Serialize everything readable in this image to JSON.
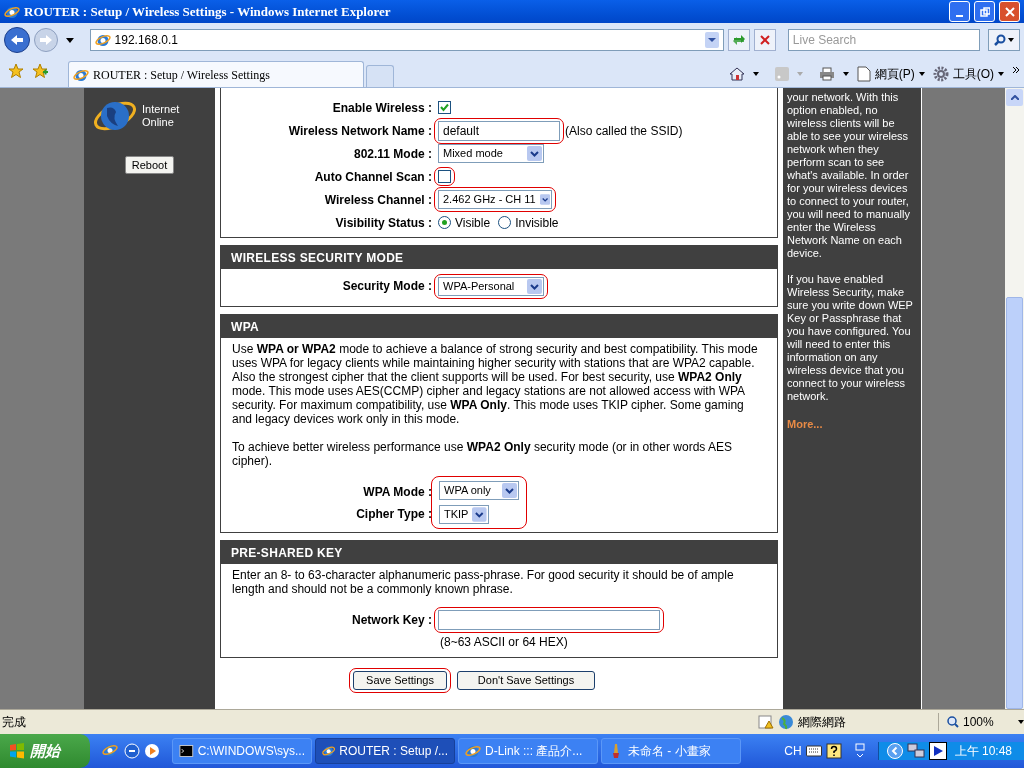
{
  "window": {
    "title": "ROUTER : Setup / Wireless Settings - Windows Internet Explorer"
  },
  "address_bar": {
    "url": "192.168.0.1",
    "search_placeholder": "Live Search"
  },
  "tabs": [
    {
      "label": "ROUTER : Setup / Wireless Settings",
      "selected": true
    }
  ],
  "command_bar": {
    "page_menu": "網頁(P)",
    "tools_menu": "工具(O)"
  },
  "router_sidebar": {
    "status": "Internet Online",
    "reboot": "Reboot"
  },
  "sections": [
    {
      "fields": [
        {
          "kind": "checkbox",
          "label": "Enable Wireless :",
          "checked": true,
          "highlighted": false
        },
        {
          "kind": "text",
          "label": "Wireless Network Name :",
          "value": "default",
          "note": "(Also called the SSID)",
          "highlighted": true
        },
        {
          "kind": "select",
          "label": "802.11 Mode :",
          "value": "Mixed mode",
          "highlighted": false
        },
        {
          "kind": "checkbox",
          "label": "Auto Channel Scan :",
          "checked": false,
          "highlighted": true
        },
        {
          "kind": "select",
          "label": "Wireless Channel :",
          "value": "2.462 GHz - CH 11",
          "highlighted": true
        },
        {
          "kind": "radio",
          "label": "Visibility Status :",
          "highlighted": false,
          "options": [
            {
              "label": "Visible",
              "selected": true
            },
            {
              "label": "Invisible",
              "selected": false
            }
          ]
        }
      ]
    },
    {
      "title": "WIRELESS SECURITY MODE",
      "fields": [
        {
          "kind": "select",
          "label": "Security Mode :",
          "value": "WPA-Personal",
          "highlighted": true
        }
      ]
    },
    {
      "title": "WPA",
      "paragraphs": [
        "Use **WPA or WPA2** mode to achieve a balance of strong security and best compatibility. This mode uses WPA for legacy clients while maintaining higher security with stations that are WPA2 capable. Also the strongest cipher that the client supports will be used. For best security, use **WPA2 Only** mode. This mode uses AES(CCMP) cipher and legacy stations are not allowed access with WPA security. For maximum compatibility, use **WPA Only**. This mode uses TKIP cipher. Some gaming and legacy devices work only in this mode.",
        "To achieve better wireless performance use **WPA2 Only** security mode (or in other words AES cipher)."
      ],
      "group_highlighted": true,
      "fields": [
        {
          "kind": "select",
          "label": "WPA Mode :",
          "value": "WPA only",
          "highlighted": false
        },
        {
          "kind": "select",
          "label": "Cipher Type :",
          "value": "TKIP",
          "highlighted": false
        }
      ]
    },
    {
      "title": "PRE-SHARED KEY",
      "paragraphs": [
        "Enter an 8- to 63-character alphanumeric pass-phrase. For good security it should be of ample length and should not be a commonly known phrase."
      ],
      "fields": [
        {
          "kind": "text",
          "label": "Network Key :",
          "highlighted": true,
          "hint": "(8~63 ASCII or 64 HEX)"
        }
      ]
    }
  ],
  "buttons": [
    {
      "label": "Save Settings",
      "highlighted": true
    },
    {
      "label": "Don't Save Settings",
      "highlighted": false
    }
  ],
  "help": {
    "paragraphs": [
      "your network. With this option enabled, no wireless clients will be able to see your wireless network when they perform scan to see what's available. In order for your wireless devices to connect to your router, you will need to manually enter the Wireless Network Name on each device.",
      "If you have enabled Wireless Security, make sure you write down WEP Key or Passphrase that you have configured. You will need to enter this information on any wireless device that you connect to your wireless network."
    ],
    "link": "More..."
  },
  "status_bar": {
    "text": "完成",
    "zone": "網際網路",
    "zoom": "100%"
  },
  "taskbar": {
    "start": "開始",
    "tasks": [
      {
        "label": "C:\\WINDOWS\\sys...",
        "selected": false
      },
      {
        "label": "ROUTER : Setup /...",
        "selected": true
      },
      {
        "label": "D-Link ::: 產品介...",
        "selected": false
      },
      {
        "label": "未命名 - 小畫家",
        "selected": false
      }
    ],
    "language": "CH",
    "clock": "上午 10:48"
  }
}
